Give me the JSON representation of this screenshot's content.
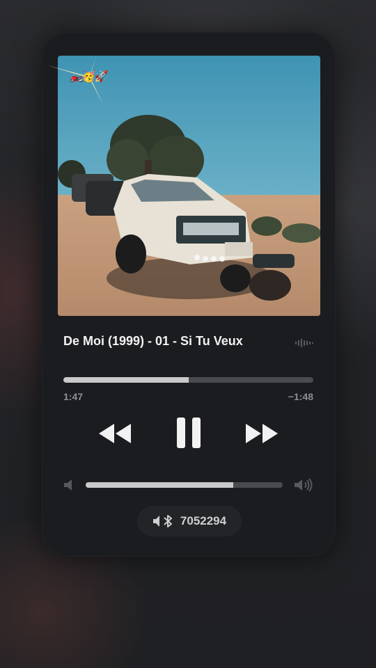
{
  "track": {
    "title": "De Moi (1999) - 01 - Si Tu Veux",
    "elapsed": "1:47",
    "remaining": "−1:48",
    "progress": 0.5
  },
  "album_art": {
    "icon": "album-artwork",
    "stickers": "🏍️🥳🚀"
  },
  "controls": {
    "rewind_icon": "rewind-icon",
    "pause_icon": "pause-icon",
    "forward_icon": "fast-forward-icon"
  },
  "volume": {
    "level": 0.75,
    "low_icon": "volume-low-icon",
    "high_icon": "volume-high-icon"
  },
  "output_device": {
    "label": "7052294",
    "icon": "speaker-bluetooth-icon"
  },
  "colors": {
    "card": "#1b1c1f",
    "track_fill": "#c9c9cb",
    "track_empty": "#4a4b4f",
    "text_primary": "#f2f2f2",
    "text_secondary": "#8d8e92"
  }
}
